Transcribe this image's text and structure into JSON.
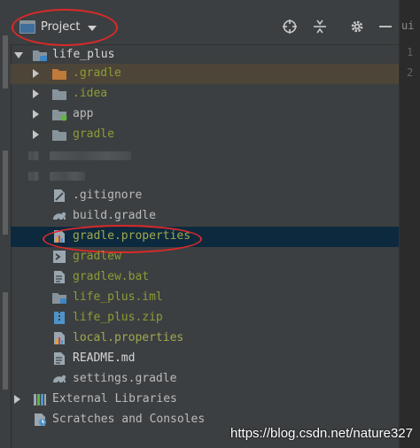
{
  "toolbar": {
    "view_label": "Project"
  },
  "right_panel": {
    "tab_text": "ui",
    "line_numbers": [
      "1",
      "2"
    ]
  },
  "tree": {
    "root": "life_plus",
    "items": [
      {
        "label": ".gradle"
      },
      {
        "label": ".idea"
      },
      {
        "label": "app"
      },
      {
        "label": "gradle"
      },
      {
        "label": ".gitignore"
      },
      {
        "label": "build.gradle"
      },
      {
        "label": "gradle.properties"
      },
      {
        "label": "gradlew"
      },
      {
        "label": "gradlew.bat"
      },
      {
        "label": "life_plus.iml"
      },
      {
        "label": "life_plus.zip"
      },
      {
        "label": "local.properties"
      },
      {
        "label": "README.md"
      },
      {
        "label": "settings.gradle"
      }
    ],
    "external_libraries": "External Libraries",
    "scratches": "Scratches and Consoles"
  },
  "watermark": "https://blog.csdn.net/nature327",
  "colors": {
    "annotation": "#d92a2a",
    "selected_row": "#0d293e",
    "ignored_row": "#4d4538"
  }
}
